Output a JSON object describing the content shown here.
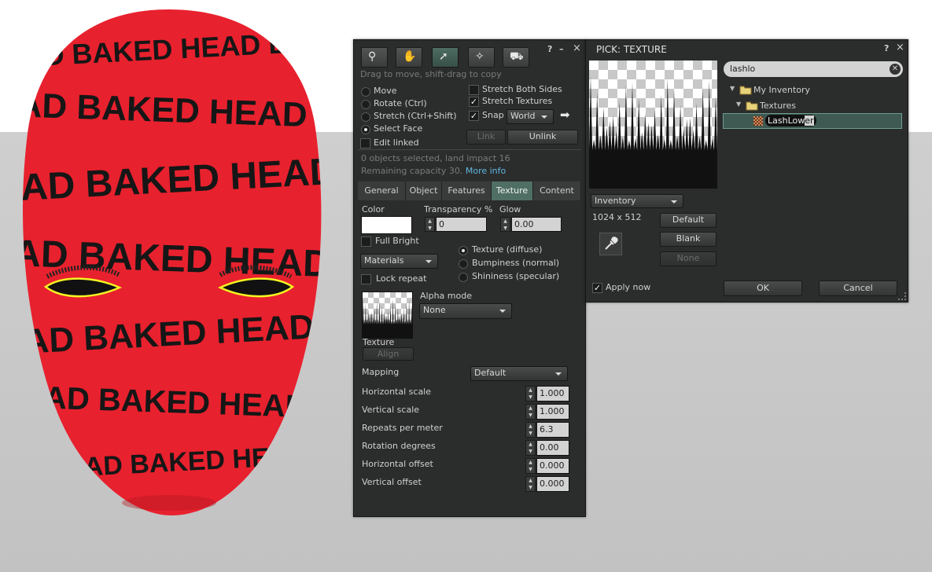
{
  "scene": {
    "baked_text": "HEAD BAKED"
  },
  "build": {
    "tools": [
      {
        "name": "focus-tool",
        "icon": "magnifier-icon",
        "active": false
      },
      {
        "name": "move-tool",
        "icon": "hand-icon",
        "active": false
      },
      {
        "name": "edit-tool",
        "icon": "pointer-icon",
        "active": true
      },
      {
        "name": "create-tool",
        "icon": "magic-wand-icon",
        "active": false
      },
      {
        "name": "land-tool",
        "icon": "bulldozer-icon",
        "active": false
      }
    ],
    "help": "?",
    "minimize": "–",
    "close": "×",
    "hint": "Drag to move, shift-drag to copy",
    "radios": {
      "move": "Move",
      "rotate": "Rotate (Ctrl)",
      "stretch": "Stretch (Ctrl+Shift)",
      "select_face": "Select Face"
    },
    "edit_linked": "Edit linked",
    "stretch_both": "Stretch Both Sides",
    "stretch_textures": "Stretch Textures",
    "snap": "Snap",
    "snap_mode": "World",
    "link": "Link",
    "unlink": "Unlink",
    "info1": "0 objects selected, land impact 16",
    "info2": "Remaining capacity 30.",
    "more_info": "More info",
    "tabs": [
      "General",
      "Object",
      "Features",
      "Texture",
      "Content"
    ],
    "texture": {
      "color_label": "Color",
      "transparency_label": "Transparency %",
      "transparency_value": "0",
      "glow_label": "Glow",
      "glow_value": "0.00",
      "full_bright": "Full Bright",
      "materials": "Materials",
      "lock_repeat": "Lock repeat",
      "map_diffuse": "Texture (diffuse)",
      "map_bump": "Bumpiness (normal)",
      "map_shiny": "Shininess (specular)",
      "alpha_mode_label": "Alpha mode",
      "alpha_mode": "None",
      "texture_label": "Texture",
      "align": "Align",
      "mapping_label": "Mapping",
      "mapping": "Default",
      "rows": [
        {
          "label": "Horizontal scale",
          "value": "1.000"
        },
        {
          "label": "Vertical scale",
          "value": "1.000"
        },
        {
          "label": "Repeats per meter",
          "value": "6.3"
        },
        {
          "label": "Rotation degrees",
          "value": "0.00"
        },
        {
          "label": "Horizontal offset",
          "value": "0.000"
        },
        {
          "label": "Vertical offset",
          "value": "0.000"
        }
      ]
    }
  },
  "picker": {
    "title": "PICK: TEXTURE",
    "help": "?",
    "close": "×",
    "source": "Inventory",
    "dimensions": "1024 x 512",
    "default": "Default",
    "blank": "Blank",
    "none": "None",
    "apply_now": "Apply now",
    "ok": "OK",
    "cancel": "Cancel",
    "search": "lashlo",
    "tree": {
      "root": "My Inventory",
      "folder": "Textures",
      "item_pre": "LashL",
      "item_match": "ow",
      "item_post": "er"
    }
  },
  "colors": {
    "accent": "#4f6f65",
    "panel": "#2b2c2c",
    "head_red": "#e8212e",
    "highlight": "#f5f521"
  }
}
